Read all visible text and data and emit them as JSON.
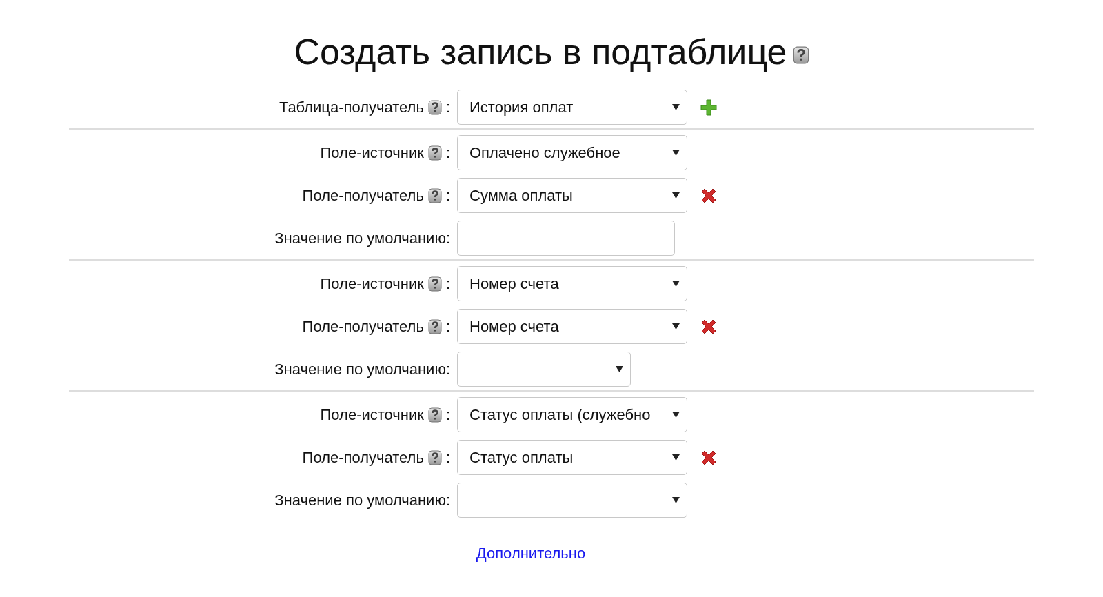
{
  "title": "Создать запись в подтаблице",
  "title_help": true,
  "target_table": {
    "label": {
      "text": "Таблица-получатель",
      "help": true,
      "suffix": ":"
    },
    "value": "История оплат",
    "add_button": true
  },
  "mappings": [
    {
      "source": {
        "label": {
          "text": "Поле-источник",
          "help": true,
          "suffix": ":"
        },
        "value": "Оплачено служебное"
      },
      "target": {
        "label": {
          "text": "Поле-получатель",
          "help": true,
          "suffix": ":"
        },
        "value": "Сумма оплаты",
        "remove_button": true
      },
      "default": {
        "label": {
          "text": "Значение по умолчанию:",
          "help": false
        },
        "kind": "text"
      }
    },
    {
      "source": {
        "label": {
          "text": "Поле-источник",
          "help": true,
          "suffix": ":"
        },
        "value": "Номер счета"
      },
      "target": {
        "label": {
          "text": "Поле-получатель",
          "help": true,
          "suffix": ":"
        },
        "value": "Номер счета",
        "remove_button": true
      },
      "default": {
        "label": {
          "text": "Значение по умолчанию:",
          "help": false
        },
        "kind": "compact"
      }
    },
    {
      "source": {
        "label": {
          "text": "Поле-источник",
          "help": true,
          "suffix": ":"
        },
        "value": "Статус оплаты (служебно"
      },
      "target": {
        "label": {
          "text": "Поле-получатель",
          "help": true,
          "suffix": ":"
        },
        "value": "Статус оплаты",
        "remove_button": true
      },
      "default": {
        "label": {
          "text": "Значение по умолчанию:",
          "help": false
        },
        "kind": "select"
      }
    }
  ],
  "more_link": "Дополнительно"
}
